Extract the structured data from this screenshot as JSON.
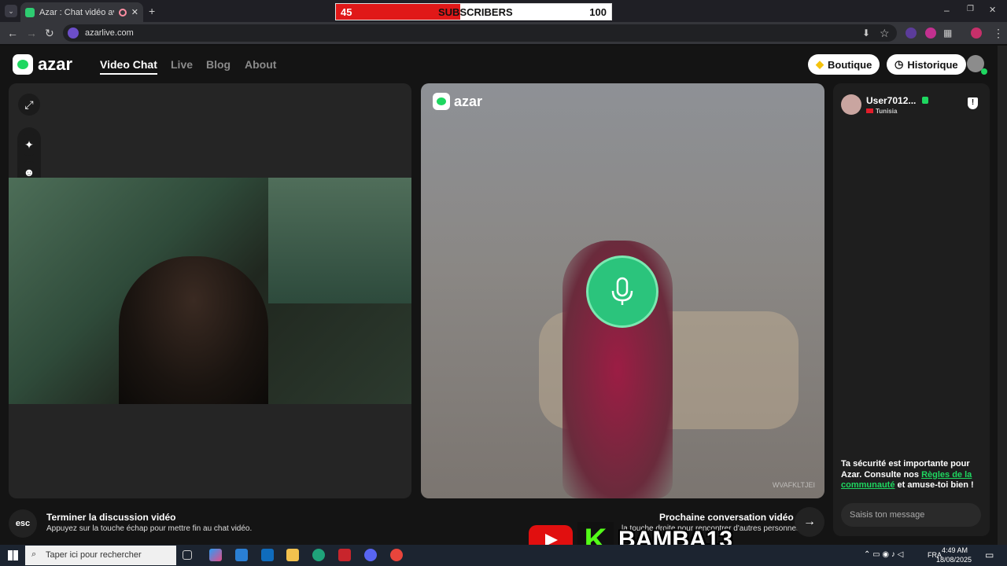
{
  "browser": {
    "tab_title": "Azar : Chat vidéo avec de r",
    "new_tab": "+",
    "url": "azarlive.com",
    "window_controls": [
      "–",
      "❐",
      "✕"
    ]
  },
  "subscriber_goal": {
    "current": "45",
    "label": "SUBSCRIBERS",
    "target": "100",
    "progress": 0.45,
    "fill_color": "#e01818"
  },
  "site": {
    "logo": "azar",
    "nav": [
      "Video Chat",
      "Live",
      "Blog",
      "About"
    ],
    "boutique": "Boutique",
    "historique": "Historique",
    "accent": "#1ed760"
  },
  "remote": {
    "logo": "azar",
    "watermark": "WVAFKLTJEI"
  },
  "chat": {
    "username": "User7012...",
    "country": "Tunisia",
    "safety_prefix": "Ta sécurité est importante pour Azar. Consulte nos ",
    "safety_link": "Règles de la communauté",
    "safety_suffix": " et amuse-toi bien !",
    "placeholder": "Saisis ton message"
  },
  "footer": {
    "esc": "esc",
    "end_title": "Terminer la discussion vidéo",
    "end_sub": "Appuyez sur la touche échap pour mettre fin au chat vidéo.",
    "next_title": "Prochaine conversation vidéo",
    "next_sub": "la touche droite pour rencontrer d'autres personnes"
  },
  "overlay": {
    "channel": "BAMBA13",
    "k": "K"
  },
  "taskbar": {
    "search_placeholder": "Taper ici pour rechercher",
    "language": "FRA",
    "time": "4:49 AM",
    "date": "18/08/2025"
  }
}
